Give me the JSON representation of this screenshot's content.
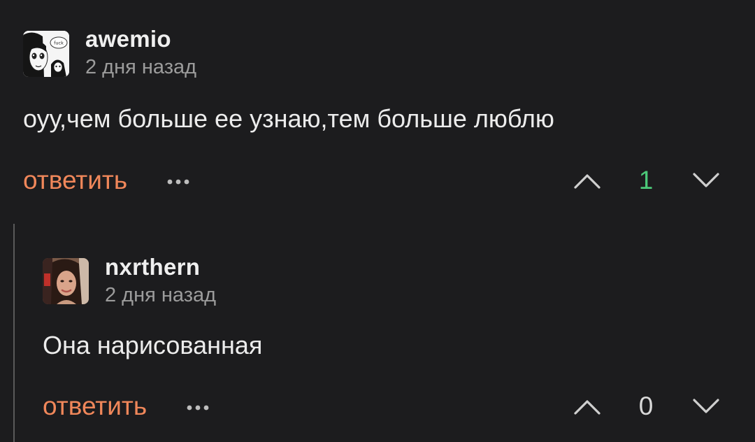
{
  "comments": [
    {
      "username": "awemio",
      "timestamp": "2 дня назад",
      "text": "оуу,чем больше ее узнаю,тем больше люблю",
      "reply_label": "ответить",
      "vote_count": "1",
      "vote_color": "#4cc979",
      "avatar_text": "fuck"
    },
    {
      "username": "nxrthern",
      "timestamp": "2 дня назад",
      "text": "Она нарисованная",
      "reply_label": "ответить",
      "vote_count": "0",
      "vote_color": "#d8d8d8"
    }
  ],
  "colors": {
    "background": "#1c1c1e",
    "reply_accent": "#f0875a",
    "muted": "#9c9c9c"
  }
}
